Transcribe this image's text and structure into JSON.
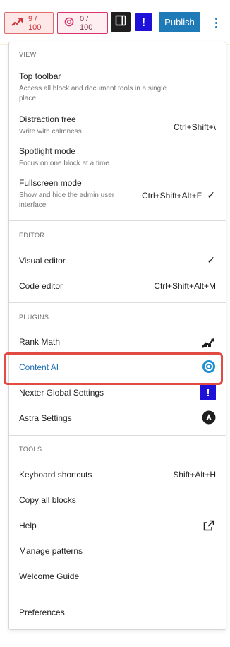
{
  "toolbar": {
    "rank_math_score": "9 / 100",
    "content_ai_score": "0 / 100",
    "publish_label": "Publish",
    "colors": {
      "publish": "#1f7ab8",
      "nexter": "#1d10d8",
      "rank_math": "#c9363b"
    }
  },
  "menu": {
    "view": {
      "label": "VIEW",
      "items": [
        {
          "label": "Top toolbar",
          "description": "Access all block and document tools in a single place"
        },
        {
          "label": "Distraction free",
          "description": "Write with calmness",
          "shortcut": "Ctrl+Shift+\\"
        },
        {
          "label": "Spotlight mode",
          "description": "Focus on one block at a time"
        },
        {
          "label": "Fullscreen mode",
          "description": "Show and hide the admin user interface",
          "shortcut": "Ctrl+Shift+Alt+F",
          "checked": true
        }
      ]
    },
    "editor": {
      "label": "EDITOR",
      "items": [
        {
          "label": "Visual editor",
          "checked": true
        },
        {
          "label": "Code editor",
          "shortcut": "Ctrl+Shift+Alt+M"
        }
      ]
    },
    "plugins": {
      "label": "PLUGINS",
      "items": [
        {
          "label": "Rank Math",
          "icon": "rank-math-icon"
        },
        {
          "label": "Content AI",
          "icon": "content-ai-icon",
          "highlighted": true
        },
        {
          "label": "Nexter Global Settings",
          "icon": "nexter-icon"
        },
        {
          "label": "Astra Settings",
          "icon": "astra-icon"
        }
      ]
    },
    "tools": {
      "label": "TOOLS",
      "items": [
        {
          "label": "Keyboard shortcuts",
          "shortcut": "Shift+Alt+H"
        },
        {
          "label": "Copy all blocks"
        },
        {
          "label": "Help",
          "icon": "external-link-icon"
        },
        {
          "label": "Manage patterns"
        },
        {
          "label": "Welcome Guide"
        }
      ]
    },
    "preferences": {
      "label": "Preferences"
    }
  }
}
